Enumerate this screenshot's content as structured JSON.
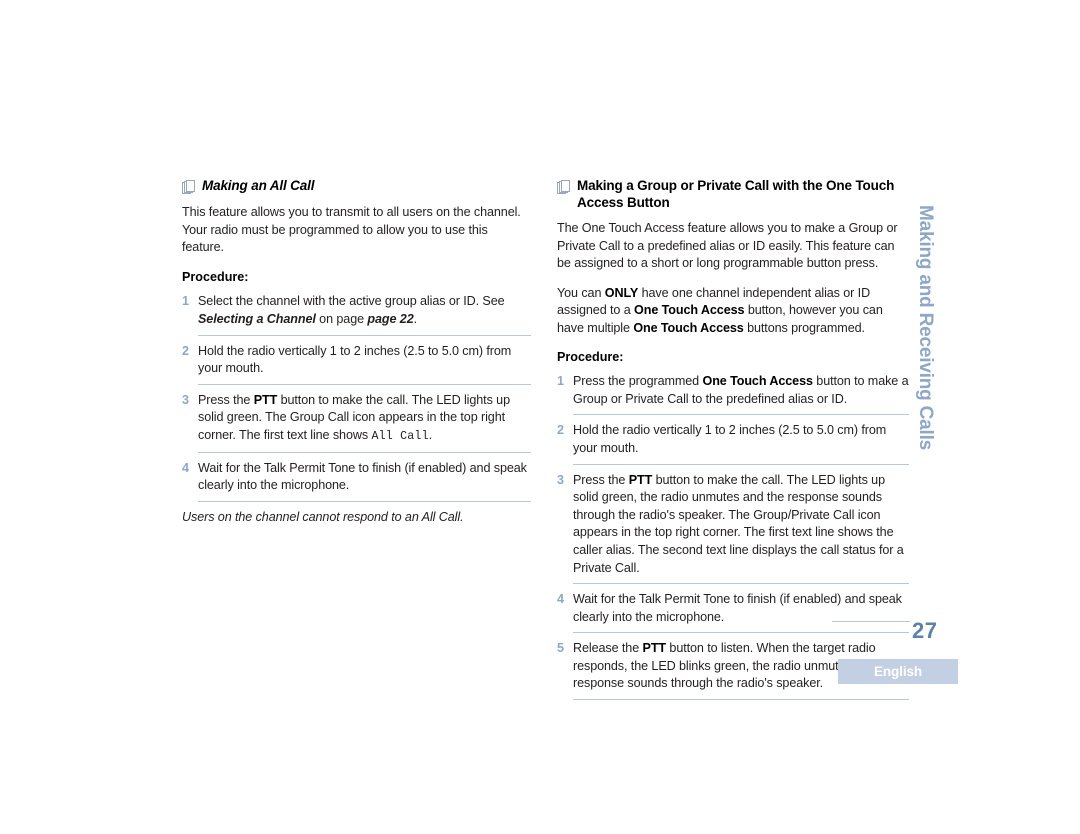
{
  "document": {
    "page_number": "27",
    "language_badge": "English",
    "chapter_tab": "Making and Receiving Calls",
    "colors": {
      "accent_blue": "#5d81ab",
      "step_number_blue": "#8ea7c6",
      "rule_blue": "#b9c6da",
      "badge_background": "#c3cfe2",
      "text": "#231f20"
    }
  },
  "left_column": {
    "heading": "Making an All Call",
    "heading_icon": "document-pages-icon",
    "intro": "This feature allows you to transmit to all users on the channel. Your radio must be programmed to allow you to use this feature.",
    "procedure_label": "Procedure:",
    "steps": [
      {
        "number": "1",
        "text_parts": [
          {
            "type": "plain",
            "text": "Select the channel with the active group alias or ID. See "
          },
          {
            "type": "bold-italic",
            "text": "Selecting a Channel"
          },
          {
            "type": "plain",
            "text": " on page "
          },
          {
            "type": "bold-italic",
            "text": "page 22"
          },
          {
            "type": "plain",
            "text": "."
          }
        ]
      },
      {
        "number": "2",
        "text_parts": [
          {
            "type": "plain",
            "text": "Hold the radio vertically 1 to 2 inches (2.5 to 5.0 cm) from your mouth."
          }
        ]
      },
      {
        "number": "3",
        "text_parts": [
          {
            "type": "plain",
            "text": "Press the "
          },
          {
            "type": "bold",
            "text": "PTT"
          },
          {
            "type": "plain",
            "text": " button to make the call. The LED lights up solid green. The Group Call icon appears in the top right corner. The first text line shows "
          },
          {
            "type": "mono",
            "text": "All Call"
          },
          {
            "type": "plain",
            "text": "."
          }
        ]
      },
      {
        "number": "4",
        "text_parts": [
          {
            "type": "plain",
            "text": "Wait for the Talk Permit Tone to finish (if enabled) and speak clearly into the microphone."
          }
        ]
      }
    ],
    "note": "Users on the channel cannot respond to an All Call."
  },
  "right_column": {
    "heading": "Making a Group or Private Call with the One Touch Access Button",
    "heading_icon": "document-pages-icon",
    "intro_1": "The One Touch Access feature allows you to make a Group or Private Call to a predefined alias or ID easily. This feature can be assigned to a short or long programmable button press.",
    "intro_2_parts": [
      {
        "type": "plain",
        "text": "You can "
      },
      {
        "type": "bold",
        "text": "ONLY"
      },
      {
        "type": "plain",
        "text": " have one channel independent alias or ID assigned to a "
      },
      {
        "type": "bold",
        "text": "One Touch Access"
      },
      {
        "type": "plain",
        "text": " button, however you can have multiple "
      },
      {
        "type": "bold",
        "text": "One Touch Access"
      },
      {
        "type": "plain",
        "text": " buttons programmed."
      }
    ],
    "procedure_label": "Procedure:",
    "steps": [
      {
        "number": "1",
        "text_parts": [
          {
            "type": "plain",
            "text": "Press the programmed "
          },
          {
            "type": "bold",
            "text": "One Touch Access"
          },
          {
            "type": "plain",
            "text": " button to make a Group or Private Call to the predefined alias or ID."
          }
        ]
      },
      {
        "number": "2",
        "text_parts": [
          {
            "type": "plain",
            "text": "Hold the radio vertically 1 to 2 inches (2.5 to 5.0 cm) from your mouth."
          }
        ]
      },
      {
        "number": "3",
        "text_parts": [
          {
            "type": "plain",
            "text": "Press the "
          },
          {
            "type": "bold",
            "text": "PTT"
          },
          {
            "type": "plain",
            "text": " button to make the call. The LED lights up solid green, the radio unmutes and the response sounds through the radio's speaker. The Group/Private Call icon appears in the top right corner. The first text line shows the caller alias. The second text line displays the call status for a Private Call."
          }
        ]
      },
      {
        "number": "4",
        "text_parts": [
          {
            "type": "plain",
            "text": "Wait for the Talk Permit Tone to finish (if enabled) and speak clearly into the microphone."
          }
        ]
      },
      {
        "number": "5",
        "text_parts": [
          {
            "type": "plain",
            "text": "Release the "
          },
          {
            "type": "bold",
            "text": "PTT"
          },
          {
            "type": "plain",
            "text": " button to listen. When the target radio responds, the LED blinks green, the radio unmutes and the response sounds through the radio's speaker."
          }
        ]
      }
    ]
  }
}
